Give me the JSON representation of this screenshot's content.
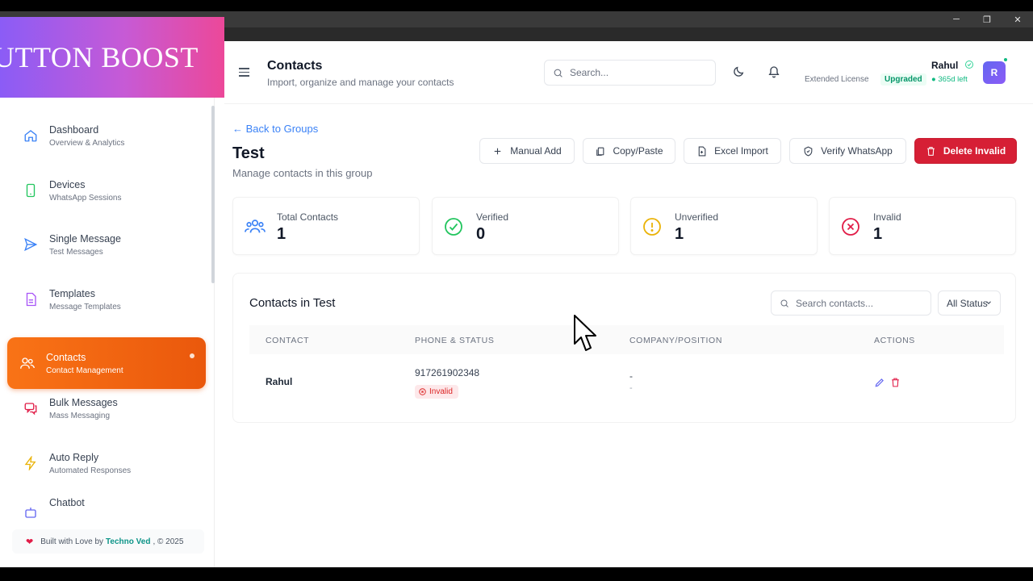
{
  "window": {
    "minimize": "─",
    "maximize": "❐",
    "close": "✕"
  },
  "logo": {
    "text": "UTTON BOOST"
  },
  "sidebar": {
    "items": [
      {
        "label": "Dashboard",
        "sub": "Overview & Analytics",
        "icon": "home-icon"
      },
      {
        "label": "Devices",
        "sub": "WhatsApp Sessions",
        "icon": "phone-icon"
      },
      {
        "label": "Single Message",
        "sub": "Test Messages",
        "icon": "send-icon"
      },
      {
        "label": "Templates",
        "sub": "Message Templates",
        "icon": "file-icon"
      },
      {
        "label": "Contacts",
        "sub": "Contact Management",
        "icon": "users-icon",
        "active": true
      },
      {
        "label": "Bulk Messages",
        "sub": "Mass Messaging",
        "icon": "chat-icon"
      },
      {
        "label": "Auto Reply",
        "sub": "Automated Responses",
        "icon": "bolt-icon"
      },
      {
        "label": "Chatbot",
        "sub": "",
        "icon": "bot-icon"
      }
    ],
    "footer": {
      "prefix": "Built with Love by",
      "link": "Techno Ved",
      "suffix": ", © 2025"
    }
  },
  "header": {
    "title": "Contacts",
    "subtitle": "Import, organize and manage your contacts",
    "search_placeholder": "Search...",
    "user_name": "Rahul",
    "license": "Extended License",
    "plan_badge": "Upgraded",
    "days_left": "● 365d left",
    "avatar_initial": "R"
  },
  "page": {
    "back_link": "← Back to Groups",
    "title": "Test",
    "subtitle": "Manage contacts in this group",
    "actions": {
      "manual_add": "Manual Add",
      "copy_paste": "Copy/Paste",
      "excel_import": "Excel Import",
      "verify_whatsapp": "Verify WhatsApp",
      "delete_invalid": "Delete Invalid"
    },
    "stats": [
      {
        "label": "Total Contacts",
        "value": "1",
        "color": "#3b82f6"
      },
      {
        "label": "Verified",
        "value": "0",
        "color": "#22c55e"
      },
      {
        "label": "Unverified",
        "value": "1",
        "color": "#eab308"
      },
      {
        "label": "Invalid",
        "value": "1",
        "color": "#e11d48"
      }
    ]
  },
  "contacts_table": {
    "title": "Contacts in Test",
    "search_placeholder": "Search contacts...",
    "status_filter": "All Status",
    "columns": [
      "CONTACT",
      "PHONE & STATUS",
      "COMPANY/POSITION",
      "ACTIONS"
    ],
    "rows": [
      {
        "name": "Rahul",
        "phone": "917261902348",
        "status": "Invalid",
        "company": "-",
        "position": "-"
      }
    ]
  },
  "colors": {
    "accent": "#f97316",
    "danger": "#d61f35",
    "link": "#3b82f6"
  }
}
